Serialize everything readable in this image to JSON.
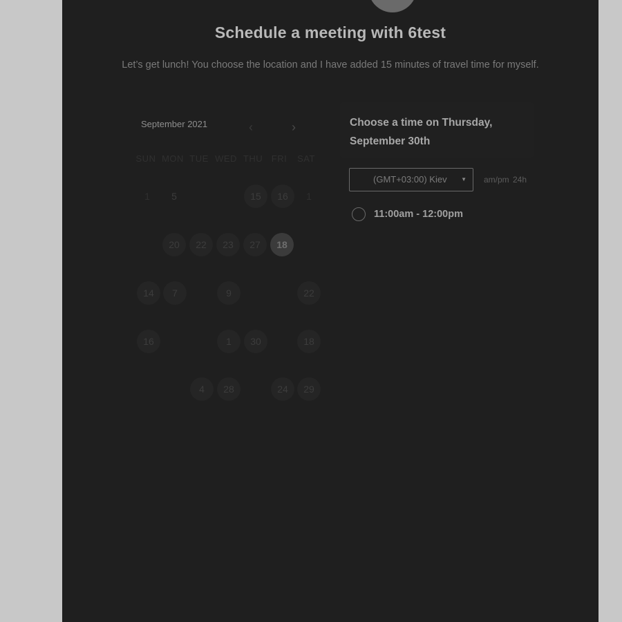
{
  "page": {
    "title": "Schedule a meeting with 6test",
    "subtitle": "Let’s get lunch! You choose the location and I have added 15 minutes of travel time for myself."
  },
  "calendar": {
    "month_label": "September 2021",
    "prev_icon": "chevron-left-icon",
    "next_icon": "chevron-right-icon",
    "weekdays": [
      "SUN",
      "MON",
      "TUE",
      "WED",
      "THU",
      "FRI",
      "SAT"
    ],
    "days": {
      "d1": "1",
      "d5": "5",
      "d15": "15",
      "d16": "16",
      "d17": "1",
      "d20": "20",
      "d22": "22",
      "d23": "23",
      "d27": "27",
      "d18": "18",
      "d14": "14",
      "d7": "7",
      "d9": "9",
      "d22b": "22",
      "d16b": "16",
      "d12": "1",
      "d30": "30",
      "d18b": "18",
      "d4": "4",
      "d28": "28",
      "d24": "24",
      "d29": "29"
    },
    "selected_day": "18"
  },
  "times": {
    "heading": "Choose a time on Thursday, September 30th",
    "timezone": "(GMT+03:00) Kiev",
    "format_ampm": "am/pm",
    "format_24h": "24h",
    "slots": [
      {
        "label": "11:00am - 12:00pm"
      }
    ]
  },
  "colors": {
    "panel_bg": "#1f1f1f",
    "outer_bg": "#c8c8c8"
  }
}
